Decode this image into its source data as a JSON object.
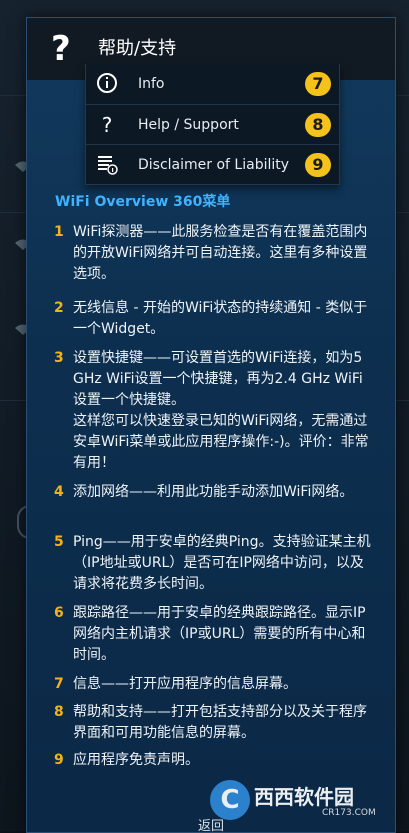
{
  "dialog": {
    "header_icon": "?",
    "title": "帮助/支持"
  },
  "menu": {
    "items": [
      {
        "icon": "info-icon",
        "label": "Info",
        "number": "7"
      },
      {
        "icon": "question-icon",
        "label": "Help / Support",
        "number": "8"
      },
      {
        "icon": "document-info-icon",
        "label": "Disclaimer of Liability",
        "number": "9"
      }
    ],
    "badge_color": "#f4c21a"
  },
  "content": {
    "title": "WiFi Overview 360菜单",
    "items": [
      {
        "num": "1",
        "text": "WiFi探测器——此服务检查是否有在覆盖范围内的开放WiFi网络并可自动连接。这里有多种设置选项。"
      },
      {
        "num": "2",
        "text": "无线信息 - 开始的WiFi状态的持续通知 - 类似于一个Widget。"
      },
      {
        "num": "3",
        "text": "设置快捷键——可设置首选的WiFi连接，如为5 GHz WiFi设置一个快捷键，再为2.4 GHz WiFi设置一个快捷键。\n这样您可以快速登录已知的WiFi网络，无需通过安卓WiFi菜单或此应用程序操作:-)。评价：非常有用！"
      },
      {
        "num": "4",
        "text": "添加网络——利用此功能手动添加WiFi网络。"
      },
      {
        "num": "5",
        "text": "Ping——用于安卓的经典Ping。支持验证某主机（IP地址或URL）是否可在IP网络中访问，以及请求将花费多长时间。"
      },
      {
        "num": "6",
        "text": "跟踪路径——用于安卓的经典跟踪路径。显示IP网络内主机请求（IP或URL）需要的所有中心和时间。"
      },
      {
        "num": "7",
        "text": "信息——打开应用程序的信息屏幕。"
      },
      {
        "num": "8",
        "text": "帮助和支持——打开包括支持部分以及关于程序界面和可用功能信息的屏幕。"
      },
      {
        "num": "9",
        "text": "应用程序免责声明。"
      }
    ],
    "title_color": "#3fb3ff",
    "number_color": "#f4b21a"
  },
  "footer": {
    "back_label": "返回"
  },
  "watermark": {
    "logo_letter": "C",
    "text": "西西软件园",
    "sub": "CR173.COM"
  }
}
